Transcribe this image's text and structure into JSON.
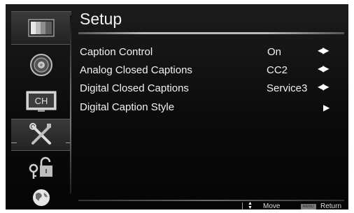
{
  "header": {
    "title": "Setup"
  },
  "sidebar": {
    "items": [
      {
        "name": "picture-menu",
        "icon": "picture-icon",
        "selected": false
      },
      {
        "name": "audio-menu",
        "icon": "speaker-icon",
        "selected": false
      },
      {
        "name": "channel-menu",
        "icon": "channel-icon",
        "label": "CH",
        "selected": false
      },
      {
        "name": "setup-menu",
        "icon": "tools-icon",
        "selected": true
      },
      {
        "name": "lock-menu",
        "icon": "lock-icon",
        "selected": false
      },
      {
        "name": "language-menu",
        "icon": "globe-icon",
        "selected": false
      }
    ]
  },
  "menu": {
    "rows": [
      {
        "label": "Caption Control",
        "value": "On",
        "arrow": "◀▶"
      },
      {
        "label": "Analog Closed Captions",
        "value": "CC2",
        "arrow": "◀▶"
      },
      {
        "label": "Digital Closed Captions",
        "value": "Service3",
        "arrow": "◀▶"
      },
      {
        "label": "Digital Caption Style",
        "value": "",
        "arrow": "▶"
      }
    ]
  },
  "footer": {
    "move_label": "Move",
    "menu_key": "MENU",
    "return_label": "Return"
  },
  "colors": {
    "background": "#0b0b0b",
    "text": "#f2f2f2",
    "selected_tab": "#2e2e2e"
  }
}
